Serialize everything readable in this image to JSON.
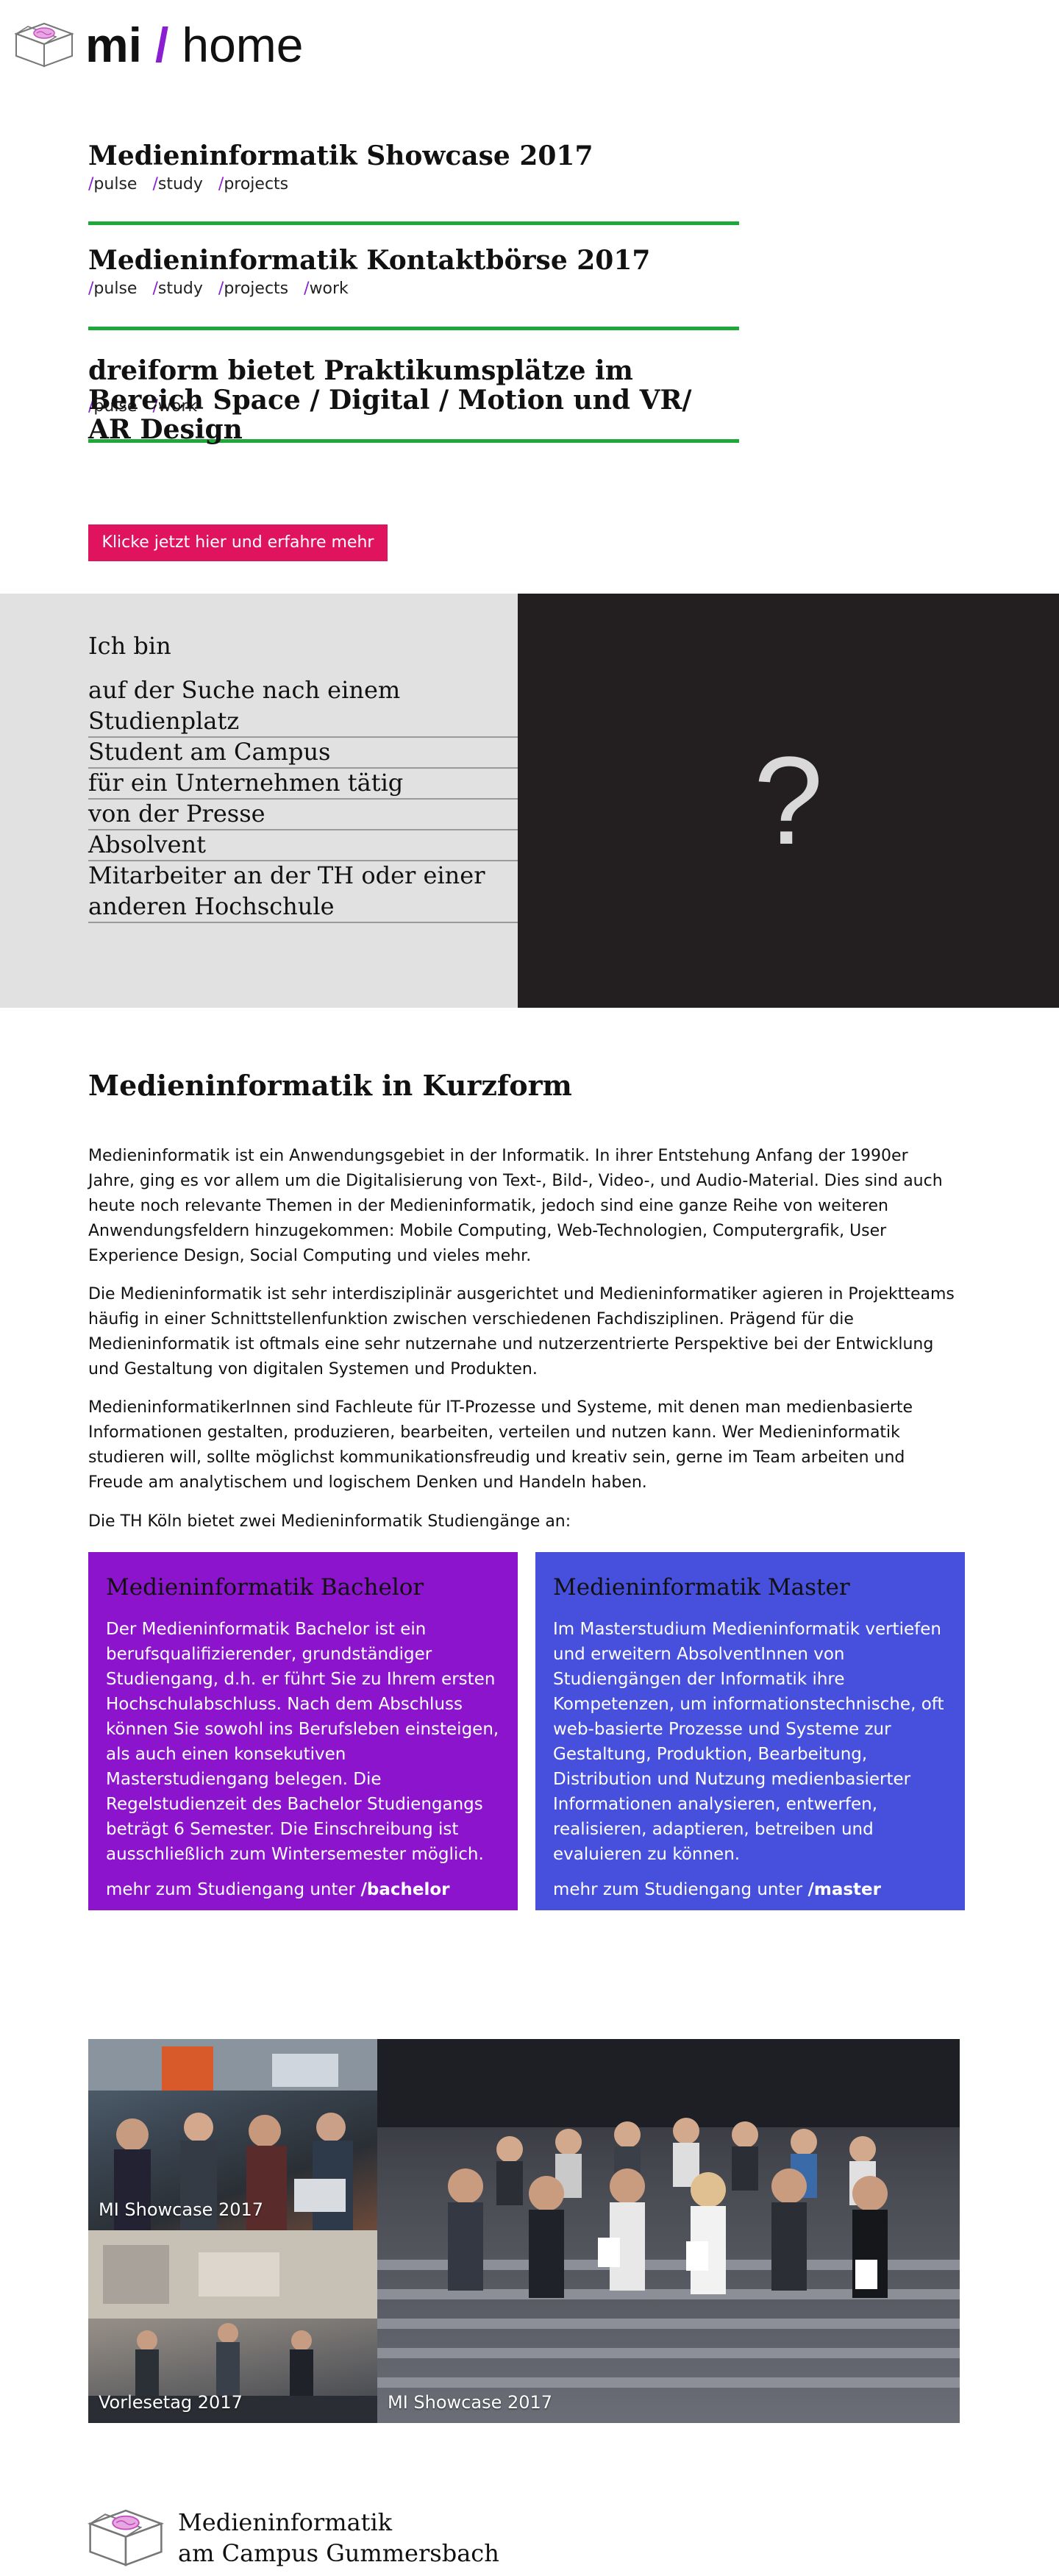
{
  "header": {
    "brand_mi": "mi",
    "brand_slash": "/",
    "brand_home": "home",
    "logo_icon": "box-with-brain-icon"
  },
  "news": [
    {
      "title": "Medieninformatik Showcase 2017",
      "tags": [
        "pulse",
        "study",
        "projects"
      ]
    },
    {
      "title": "Medieninformatik Kontaktbörse 2017",
      "tags": [
        "pulse",
        "study",
        "projects",
        "work"
      ]
    },
    {
      "title": "dreiform bietet Praktikumsplätze im Bereich Space / Digital / Motion und VR/ AR Design",
      "tags": [
        "pulse",
        "work"
      ]
    }
  ],
  "cta": {
    "label": "Klicke jetzt hier und erfahre mehr"
  },
  "ich_bin": {
    "title": "Ich bin",
    "options": [
      "auf der Suche nach einem Studienplatz",
      "Student am Campus",
      "für ein Unternehmen tätig",
      "von der Presse",
      "Absolvent",
      "Mitarbeiter an der TH oder einer anderen Hochschule"
    ],
    "placeholder_mark": "?"
  },
  "kurzform": {
    "title": "Medieninformatik in Kurzform",
    "paragraphs": [
      "Medieninformatik ist ein Anwendungsgebiet in der Informatik. In ihrer Entstehung Anfang der 1990er Jahre, ging es vor allem um die Digitalisierung von Text-, Bild-, Video-, und Audio-Material. Dies sind auch heute noch relevante Themen in der Medieninformatik, jedoch sind eine ganze Reihe von weiteren Anwendungsfeldern hinzugekommen: Mobile Computing, Web-Technologien, Computergrafik, User Experience Design, Social Computing und vieles mehr.",
      "Die Medieninformatik ist sehr interdisziplinär ausgerichtet und Medieninformatiker agieren in Projektteams häufig in einer Schnittstellenfunktion zwischen verschiedenen Fachdisziplinen. Prägend für die Medieninformatik ist oftmals eine sehr nutzernahe und nutzerzentrierte Perspektive bei der Entwicklung und Gestaltung von digitalen Systemen und Produkten.",
      "MedieninformatikerInnen sind Fachleute für IT-Prozesse und Systeme, mit denen man medienbasierte Informationen gestalten, produzieren, bearbeiten, verteilen und nutzen kann. Wer Medieninformatik studieren will, sollte möglichst kommunikationsfreudig und kreativ sein, gerne im Team arbeiten und Freude am analytischem und logischem Denken und Handeln haben.",
      "Die TH Köln bietet zwei Medieninformatik Studiengänge an:"
    ]
  },
  "cards": [
    {
      "title": "Medieninformatik Bachelor",
      "body": "Der Medieninformatik Bachelor ist ein berufsqualifizierender, grundständiger Studiengang, d.h. er führt Sie zu Ihrem ersten Hochschulabschluss. Nach dem Abschluss können Sie sowohl ins Berufsleben einsteigen, als auch einen konsekutiven Masterstudiengang belegen. Die Regelstudienzeit des Bachelor Studiengangs beträgt 6 Semester. Die Einschreibung ist ausschließlich zum Wintersemester möglich.",
      "more_prefix": "mehr zum Studiengang unter",
      "more_link": "/bachelor",
      "color": "#8b14cc"
    },
    {
      "title": "Medieninformatik Master",
      "body": "Im Masterstudium Medieninformatik vertiefen und erweitern AbsolventInnen von Studiengängen der Informatik ihre Kompetenzen, um informationstechnische, oft web-basierte Prozesse und Systeme zur Gestaltung, Produktion, Bearbeitung, Distribution und Nutzung medienbasierter Informationen analysieren, entwerfen, realisieren, adaptieren, betreiben und evaluieren zu können.",
      "more_prefix": "mehr zum Studiengang unter",
      "more_link": "/master",
      "color": "#4650dd"
    }
  ],
  "photos": [
    {
      "label": "MI Showcase 2017"
    },
    {
      "label": "Vorlesetag 2017"
    },
    {
      "label": "MI Showcase 2017"
    }
  ],
  "footer": {
    "line1": "Medieninformatik",
    "line2": "am Campus Gummersbach"
  }
}
